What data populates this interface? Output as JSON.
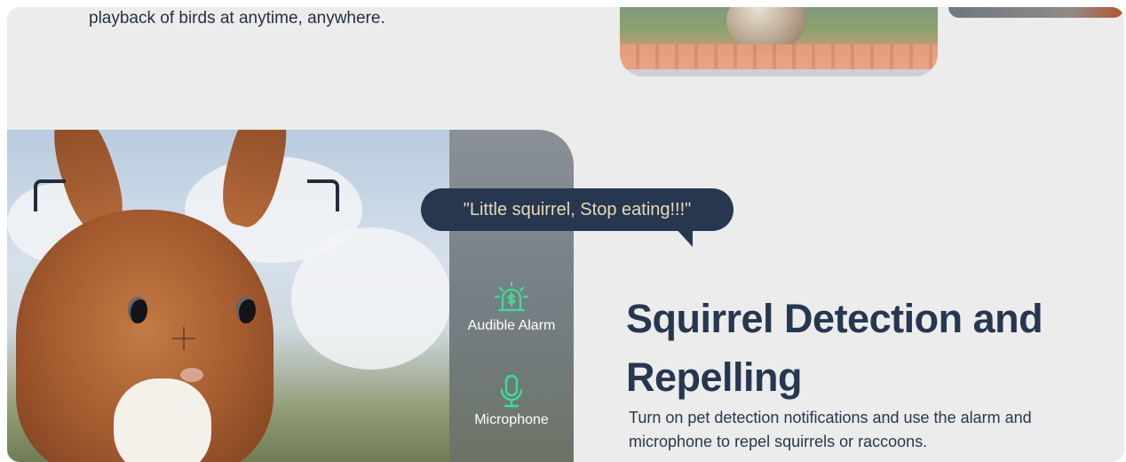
{
  "intro": {
    "text_line": "playback of birds at anytime, anywhere."
  },
  "speech_bubble": {
    "text": "\"Little squirrel, Stop eating!!!\""
  },
  "features": [
    {
      "label": "Audible Alarm",
      "icon": "alarm-icon"
    },
    {
      "label": "Microphone",
      "icon": "microphone-icon"
    }
  ],
  "section": {
    "heading": "Squirrel Detection and Repelling",
    "description": "Turn on pet detection notifications and use the alarm and microphone to repel squirrels or raccoons."
  },
  "colors": {
    "navy": "#273750",
    "accent_green": "#3ddc97",
    "bubble_text": "#e8d9b3",
    "page_bg": "#ececec"
  }
}
